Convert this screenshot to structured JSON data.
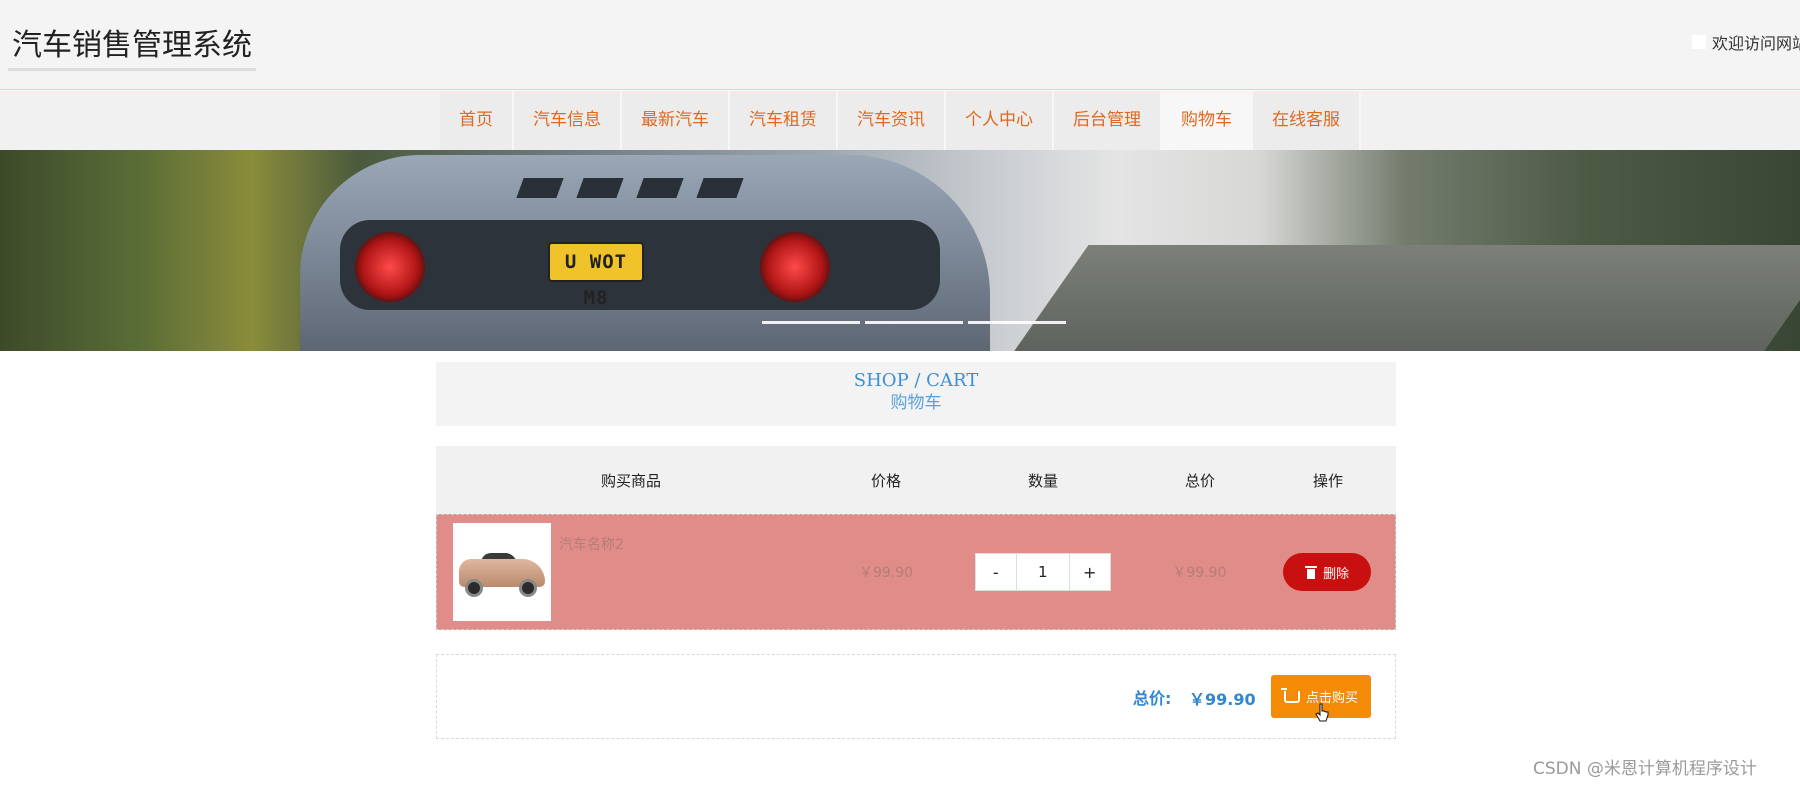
{
  "header": {
    "site_title": "汽车销售管理系统",
    "welcome": "欢迎访问网站"
  },
  "nav": {
    "items": [
      {
        "label": "首页"
      },
      {
        "label": "汽车信息"
      },
      {
        "label": "最新汽车"
      },
      {
        "label": "汽车租赁"
      },
      {
        "label": "汽车资讯"
      },
      {
        "label": "个人中心"
      },
      {
        "label": "后台管理"
      },
      {
        "label": "购物车",
        "active": true
      },
      {
        "label": "在线客服"
      }
    ]
  },
  "banner": {
    "plate_text": "U WOT M8",
    "slide_count": 3,
    "active_slide": 1
  },
  "section": {
    "title_en": "SHOP / CART",
    "title_cn": "购物车"
  },
  "cart": {
    "columns": [
      "购买商品",
      "价格",
      "数量",
      "总价",
      "操作"
    ],
    "rows": [
      {
        "name": "汽车名称2",
        "price": "￥99.90",
        "quantity": "1",
        "subtotal": "￥99.90",
        "delete_label": "删除",
        "minus_label": "-",
        "plus_label": "+"
      }
    ],
    "total_label": "总价:",
    "total_value": "￥99.90",
    "buy_label": "点击购买"
  },
  "colors": {
    "nav_text": "#e2671f",
    "row_bg": "#e08c88",
    "delete_btn": "#c91010",
    "buy_btn": "#f58a06",
    "total_text": "#2f86d2"
  },
  "watermark": "CSDN @米恩计算机程序设计"
}
